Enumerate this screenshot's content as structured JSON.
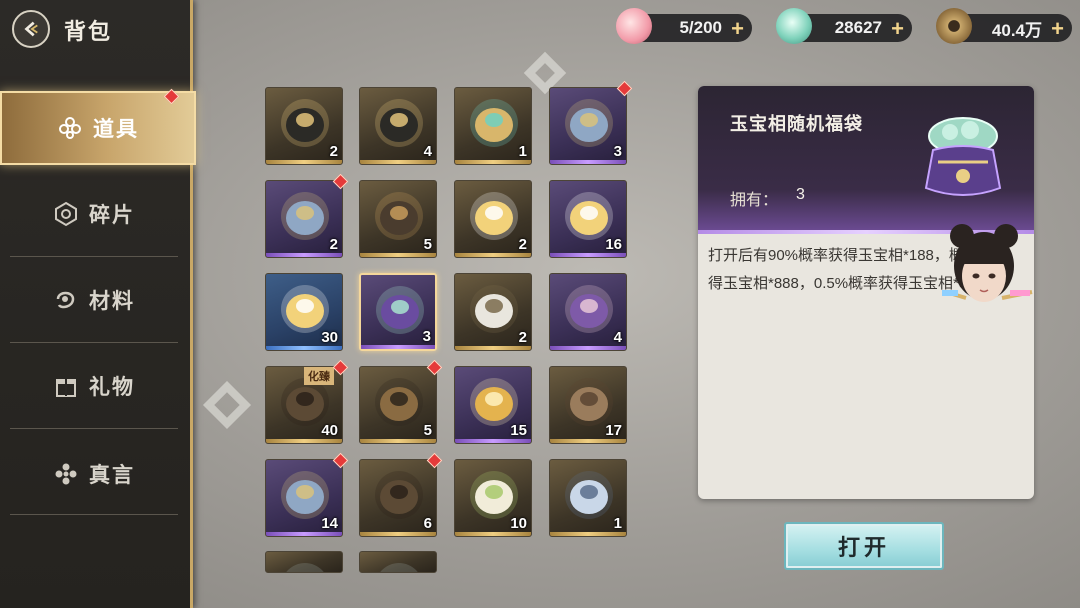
{
  "header": {
    "title": "背包"
  },
  "sidebar": {
    "items": [
      {
        "label": "道具",
        "active": true,
        "icon": "item-icon"
      },
      {
        "label": "碎片",
        "active": false,
        "icon": "fragment-icon"
      },
      {
        "label": "材料",
        "active": false,
        "icon": "material-icon"
      },
      {
        "label": "礼物",
        "active": false,
        "icon": "gift-icon"
      },
      {
        "label": "真言",
        "active": false,
        "icon": "mantra-icon"
      }
    ]
  },
  "resources": [
    {
      "name": "stamina",
      "value": "5/200",
      "icon": "peach-icon"
    },
    {
      "name": "jade",
      "value": "28627",
      "icon": "jade-icon"
    },
    {
      "name": "coin",
      "value": "40.4万",
      "icon": "coin-icon"
    }
  ],
  "inventory": [
    {
      "count": "2",
      "rarity": "gold",
      "icon": "card-icon",
      "badge": false
    },
    {
      "count": "4",
      "rarity": "gold",
      "icon": "card-icon",
      "badge": false
    },
    {
      "count": "1",
      "rarity": "gold",
      "icon": "compass-icon",
      "badge": false
    },
    {
      "count": "3",
      "rarity": "purple",
      "icon": "chest-icon",
      "badge": true
    },
    {
      "count": "2",
      "rarity": "purple",
      "icon": "chest-icon",
      "badge": true
    },
    {
      "count": "5",
      "rarity": "gold",
      "icon": "pot-icon",
      "badge": false
    },
    {
      "count": "2",
      "rarity": "gold",
      "icon": "orb-icon",
      "badge": false
    },
    {
      "count": "16",
      "rarity": "purple",
      "icon": "orb-icon",
      "badge": false
    },
    {
      "count": "30",
      "rarity": "blue",
      "icon": "orb-icon",
      "badge": false
    },
    {
      "count": "3",
      "rarity": "purple",
      "icon": "bag-icon",
      "badge": false,
      "selected": true
    },
    {
      "count": "2",
      "rarity": "gold",
      "icon": "egg-icon",
      "badge": false
    },
    {
      "count": "4",
      "rarity": "purple",
      "icon": "box-icon",
      "badge": false
    },
    {
      "count": "40",
      "rarity": "gold",
      "icon": "silhouette-icon",
      "badge": true,
      "tag": "化臻"
    },
    {
      "count": "5",
      "rarity": "gold",
      "icon": "scroll-icon",
      "badge": true
    },
    {
      "count": "15",
      "rarity": "purple",
      "icon": "feather-icon",
      "badge": false
    },
    {
      "count": "17",
      "rarity": "gold",
      "icon": "rock-icon",
      "badge": false
    },
    {
      "count": "14",
      "rarity": "purple",
      "icon": "chest-icon",
      "badge": true
    },
    {
      "count": "6",
      "rarity": "gold",
      "icon": "silhouette-icon",
      "badge": true
    },
    {
      "count": "10",
      "rarity": "gold",
      "icon": "lotus-icon",
      "badge": false
    },
    {
      "count": "1",
      "rarity": "gold",
      "icon": "ring-icon",
      "badge": false
    },
    {
      "count": "",
      "rarity": "gold",
      "icon": "flower-icon",
      "badge": false
    },
    {
      "count": "",
      "rarity": "gold",
      "icon": "flower-icon",
      "badge": false
    }
  ],
  "detail": {
    "name": "玉宝相随机福袋",
    "own_label": "拥有：",
    "own_value": "3",
    "description": "打开后有90%概率获得玉宝相*188，概率获得玉宝相*888，0.5%概率获得玉宝相*3288"
  },
  "actions": {
    "open_label": "打开"
  }
}
